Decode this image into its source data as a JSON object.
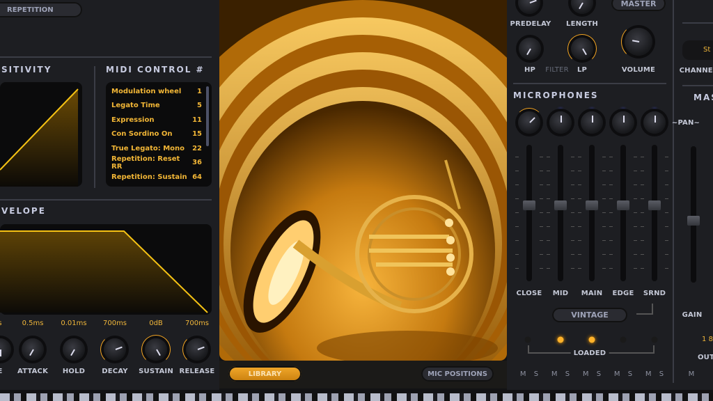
{
  "left": {
    "repetition_button": "REPETITION",
    "sensitivity_header": "SITIVITY",
    "midi_header": "MIDI CONTROL #",
    "midi_items": [
      {
        "label": "Modulation wheel",
        "cc": "1"
      },
      {
        "label": "Legato Time",
        "cc": "5"
      },
      {
        "label": "Expression",
        "cc": "11"
      },
      {
        "label": "Con Sordino On",
        "cc": "15"
      },
      {
        "label": "True Legato: Mono",
        "cc": "22"
      },
      {
        "label": "Repetition: Reset RR",
        "cc": "36"
      },
      {
        "label": "Repetition: Sustain",
        "cc": "64"
      }
    ],
    "envelope_header": "VELOPE",
    "envelope_knobs": [
      {
        "label": "E",
        "value": "s"
      },
      {
        "label": "ATTACK",
        "value": "0.5ms"
      },
      {
        "label": "HOLD",
        "value": "0.01ms"
      },
      {
        "label": "DECAY",
        "value": "700ms"
      },
      {
        "label": "SUSTAIN",
        "value": "0dB"
      },
      {
        "label": "RELEASE",
        "value": "700ms"
      }
    ]
  },
  "center": {
    "library_button": "LIBRARY",
    "mic_positions_button": "MIC POSITIONS"
  },
  "right": {
    "predelay": "PREDELAY",
    "length": "LENGTH",
    "master_button": "MASTER",
    "hp": "HP",
    "filter": "FILTER",
    "lp": "LP",
    "volume": "VOLUME",
    "microphones_header": "MICROPHONES",
    "pan": "~PAN~",
    "mics": [
      "CLOSE",
      "MID",
      "MAIN",
      "EDGE",
      "SRND"
    ],
    "mics_loaded": [
      false,
      true,
      true,
      false,
      false
    ],
    "vintage_button": "VINTAGE",
    "loaded": "LOADED",
    "ms": "M S",
    "channel": "CHANNEL",
    "channel_value": "St",
    "mas": "MAS",
    "gain": "GAIN",
    "out_value": "1 8",
    "out": "OUT",
    "m": "M"
  },
  "colors": {
    "accent": "#f5a623",
    "panel": "#1d1e22",
    "mic_led": "#5a6bff"
  }
}
